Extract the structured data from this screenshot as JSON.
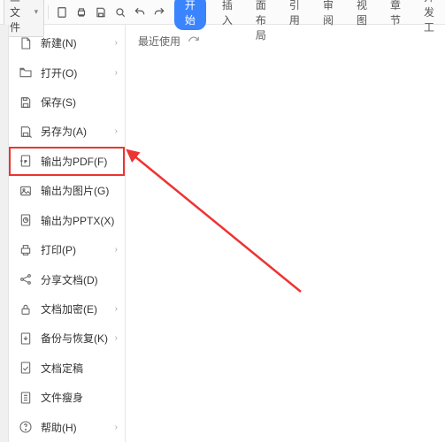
{
  "toolbar": {
    "file_label": "三 文件",
    "tabs": [
      "开始",
      "插入",
      "页面布局",
      "引用",
      "审阅",
      "视图",
      "章节",
      "开发工"
    ],
    "active_tab": 0
  },
  "menu": {
    "items": [
      {
        "label": "新建(N)",
        "sub": true,
        "icon": "file-blank-icon"
      },
      {
        "label": "打开(O)",
        "sub": true,
        "icon": "folder-open-icon"
      },
      {
        "label": "保存(S)",
        "sub": false,
        "icon": "save-icon"
      },
      {
        "label": "另存为(A)",
        "sub": true,
        "icon": "save-as-icon"
      },
      {
        "label": "输出为PDF(F)",
        "sub": false,
        "icon": "export-pdf-icon",
        "highlight": true
      },
      {
        "label": "输出为图片(G)",
        "sub": false,
        "icon": "export-image-icon"
      },
      {
        "label": "输出为PPTX(X)",
        "sub": false,
        "icon": "export-pptx-icon"
      },
      {
        "label": "打印(P)",
        "sub": true,
        "icon": "print-icon"
      },
      {
        "label": "分享文档(D)",
        "sub": false,
        "icon": "share-icon"
      },
      {
        "label": "文档加密(E)",
        "sub": true,
        "icon": "lock-icon"
      },
      {
        "label": "备份与恢复(K)",
        "sub": true,
        "icon": "backup-icon"
      },
      {
        "label": "文档定稿",
        "sub": false,
        "icon": "finalize-icon"
      },
      {
        "label": "文件瘦身",
        "sub": false,
        "icon": "compress-icon"
      },
      {
        "label": "帮助(H)",
        "sub": true,
        "icon": "help-icon"
      }
    ]
  },
  "content": {
    "recent_label": "最近使用"
  },
  "colors": {
    "accent": "#3a84ff",
    "highlight_box": "#e33"
  }
}
